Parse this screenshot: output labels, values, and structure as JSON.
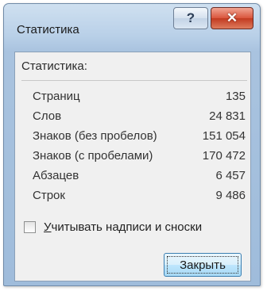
{
  "window": {
    "title": "Статистика",
    "help_glyph": "?",
    "close_glyph": "✕"
  },
  "group": {
    "label": "Статистика:"
  },
  "stats": [
    {
      "label": "Страниц",
      "value": "135"
    },
    {
      "label": "Слов",
      "value": "24 831"
    },
    {
      "label": "Знаков (без пробелов)",
      "value": "151 054"
    },
    {
      "label": "Знаков (с пробелами)",
      "value": "170 472"
    },
    {
      "label": "Абзацев",
      "value": "6 457"
    },
    {
      "label": "Строк",
      "value": "9 486"
    }
  ],
  "checkbox": {
    "mnemonic": "У",
    "rest": "читывать надписи и сноски",
    "checked": false
  },
  "buttons": {
    "close_label": "Закрыть"
  }
}
